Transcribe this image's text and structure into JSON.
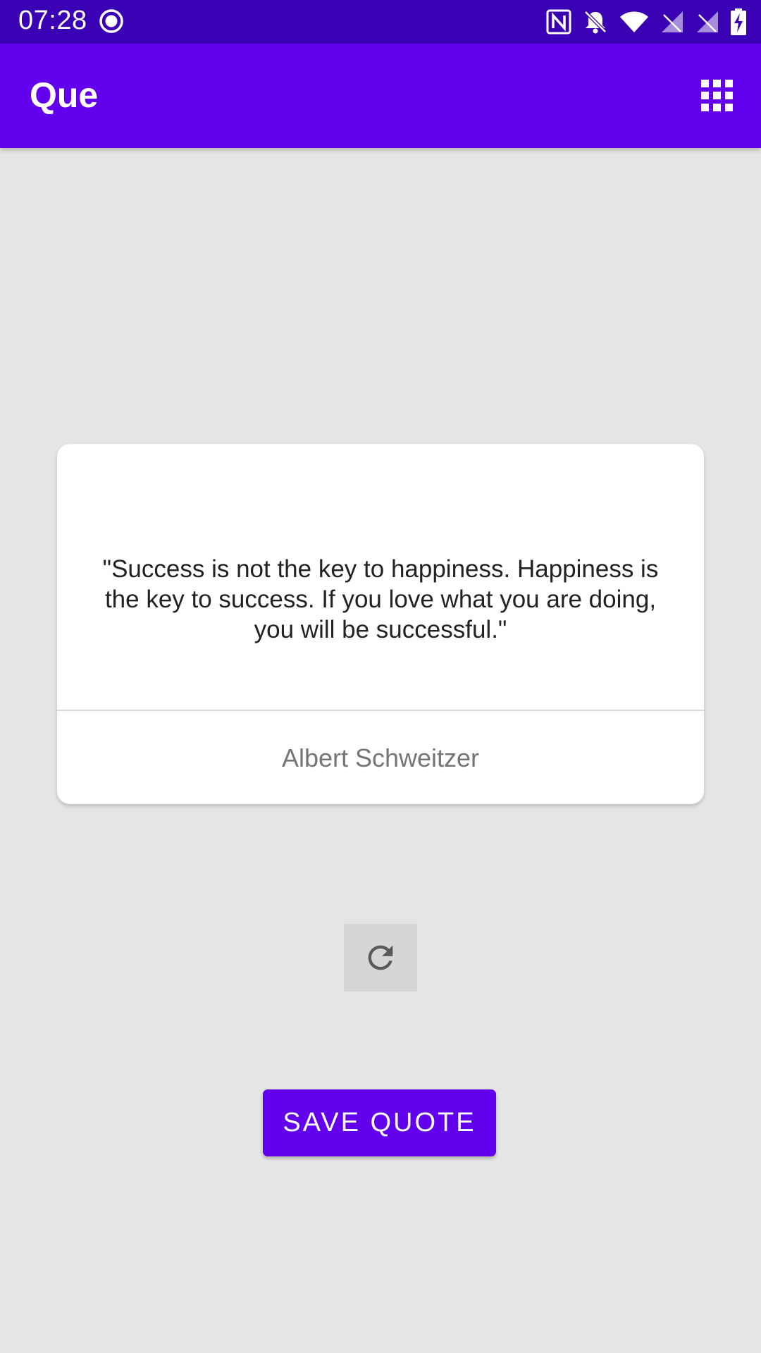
{
  "status_bar": {
    "time": "07:28",
    "icons": [
      "record-icon",
      "nfc-icon",
      "notifications-off-icon",
      "wifi-icon",
      "signal-icon",
      "signal-icon",
      "battery-charging-icon"
    ]
  },
  "app_bar": {
    "title": "Que",
    "menu_icon": "grid-icon"
  },
  "quote_card": {
    "quote": "\"Success is not the key to happiness. Happiness is the key to success. If you love what you are doing, you will be successful.\"",
    "author": "Albert Schweitzer"
  },
  "refresh": {
    "icon": "refresh-icon"
  },
  "save_button": {
    "label": "SAVE QUOTE"
  },
  "colors": {
    "status_bar": "#3a00b3",
    "primary": "#6200ee",
    "background": "#e5e5e5",
    "card": "#ffffff"
  }
}
